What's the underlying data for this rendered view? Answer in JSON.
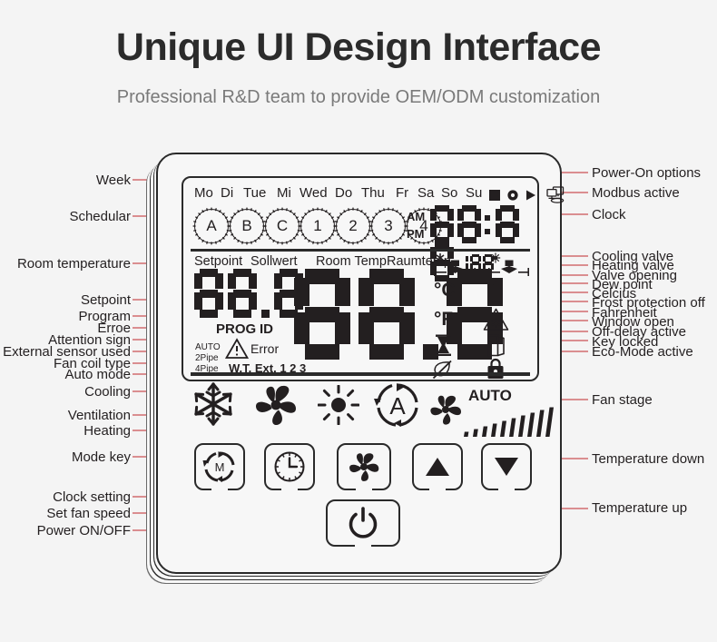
{
  "header": {
    "title": "Unique UI Design Interface",
    "subtitle": "Professional R&D team to provide OEM/ODM customization"
  },
  "colors": {
    "background": "#f4f4f4",
    "ink": "#231f20",
    "leader_line": "#c0272d",
    "device_body": "#f7f7f7",
    "subtitle_text": "#7a7a7a"
  },
  "device": {
    "lcd": {
      "weekdays": [
        "Mo",
        "Di",
        "Tue",
        "Mi",
        "Wed",
        "Do",
        "Thu",
        "Fr",
        "Sa",
        "So",
        "Su"
      ],
      "status_glyphs": [
        "square-glyph",
        "circle-glyph",
        "play-triangle-glyph"
      ],
      "modbus_icon": "networked-computers-icon",
      "schedule_dials": [
        "A",
        "B",
        "C",
        "1",
        "2",
        "3",
        "4"
      ],
      "clock": {
        "am_label": "AM",
        "pm_label": "PM",
        "value": "88:88"
      },
      "row_labels": {
        "setpoint_en": "Setpoint",
        "setpoint_de": "Sollwert",
        "roomtemp_en": "Room Temp",
        "roomtemp_de": "Raumtemp"
      },
      "setpoint_value": "88.8",
      "room_value": "88.8",
      "valve_opening_value": "188",
      "small_labels": {
        "prog": "PROG",
        "id": "ID",
        "error": "Error",
        "auto": "AUTO",
        "pipe2": "2Pipe",
        "pipe4": "4Pipe",
        "wt_ext": "W.T. Ext. 1 2 3"
      },
      "right_icons": [
        "cooling-valve-icon",
        "heating-valve-icon",
        "celsius-icon",
        "dew-point-drop-icon",
        "fahrenheit-icon",
        "frost-protection-icon",
        "off-delay-hourglass-icon",
        "window-open-icon",
        "eco-leaf-crossed-icon",
        "key-lock-icon"
      ],
      "units": {
        "celsius": "C",
        "fahrenheit": "F",
        "degree": "°"
      },
      "mode_icons": [
        "snowflake-cooling-icon",
        "fan-ventilation-icon",
        "sun-heating-icon",
        "auto-mode-a-icon"
      ],
      "fan_stage": {
        "auto_label": "AUTO",
        "bars": 10,
        "fan_icon": "fan-icon"
      }
    },
    "buttons": [
      {
        "name": "mode-key-button",
        "icon": "mode-m-icon"
      },
      {
        "name": "clock-setting-button",
        "icon": "clock-icon"
      },
      {
        "name": "fan-speed-button",
        "icon": "fan-blade-icon"
      },
      {
        "name": "temperature-up-button",
        "icon": "triangle-up-icon"
      },
      {
        "name": "temperature-down-button",
        "icon": "triangle-down-icon"
      },
      {
        "name": "power-button",
        "icon": "power-icon"
      }
    ]
  },
  "annotations": {
    "left": [
      {
        "id": "week",
        "text": "Week"
      },
      {
        "id": "schedular",
        "text": "Schedular"
      },
      {
        "id": "room-temperature",
        "text": "Room temperature"
      },
      {
        "id": "setpoint",
        "text": "Setpoint"
      },
      {
        "id": "program",
        "text": "Program"
      },
      {
        "id": "erroe",
        "text": "Erroe"
      },
      {
        "id": "attention-sign",
        "text": "Attention sign"
      },
      {
        "id": "external-sensor",
        "text": "External sensor used"
      },
      {
        "id": "fan-coil-type",
        "text": "Fan coil type"
      },
      {
        "id": "auto-mode",
        "text": "Auto mode"
      },
      {
        "id": "cooling",
        "text": "Cooling"
      },
      {
        "id": "ventilation",
        "text": "Ventilation"
      },
      {
        "id": "heating",
        "text": "Heating"
      },
      {
        "id": "mode-key",
        "text": "Mode key"
      },
      {
        "id": "clock-setting",
        "text": "Clock setting"
      },
      {
        "id": "set-fan-speed",
        "text": "Set fan speed"
      },
      {
        "id": "power-on-off",
        "text": "Power ON/OFF"
      }
    ],
    "right": [
      {
        "id": "power-on-options",
        "text": "Power-On options"
      },
      {
        "id": "modbus-active",
        "text": "Modbus  active"
      },
      {
        "id": "clock",
        "text": "Clock"
      },
      {
        "id": "cooling-valve",
        "text": "Cooling valve"
      },
      {
        "id": "heating-valve",
        "text": "Heating valve"
      },
      {
        "id": "valve-opening",
        "text": "Valve opening"
      },
      {
        "id": "dew-point",
        "text": "Dew point"
      },
      {
        "id": "celcius",
        "text": "Celcius"
      },
      {
        "id": "frost-protection",
        "text": "Frost protection off"
      },
      {
        "id": "fahrenheit",
        "text": "Fahrenheit"
      },
      {
        "id": "window-open",
        "text": "Window open"
      },
      {
        "id": "off-delay",
        "text": "Off-delay active"
      },
      {
        "id": "key-locked",
        "text": "Key locked"
      },
      {
        "id": "eco-mode",
        "text": "Eco-Mode active"
      },
      {
        "id": "fan-stage",
        "text": "Fan stage"
      },
      {
        "id": "temperature-down",
        "text": "Temperature down"
      },
      {
        "id": "temperature-up",
        "text": "Temperature up"
      }
    ]
  }
}
